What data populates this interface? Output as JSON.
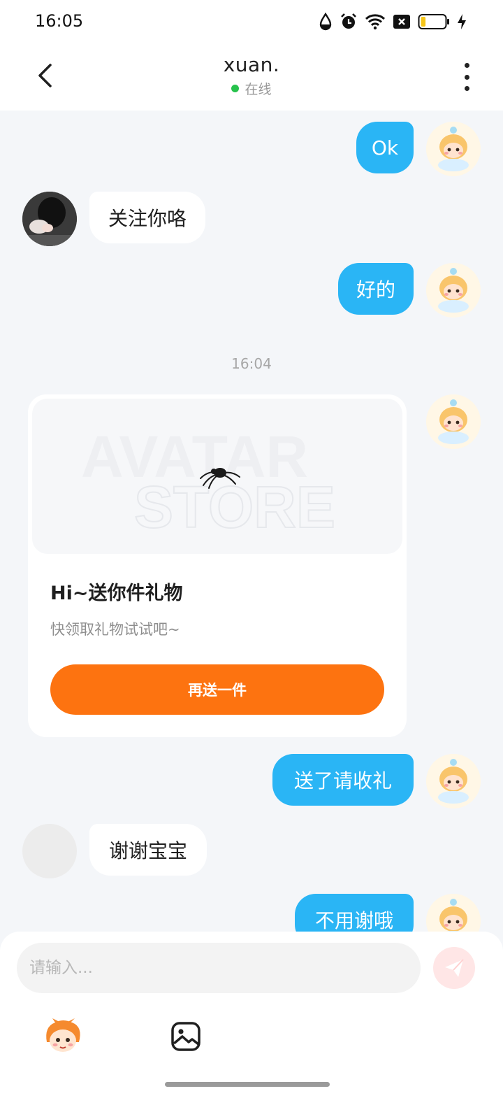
{
  "status_bar": {
    "time": "16:05",
    "icons": [
      "water-drop-icon",
      "alarm-icon",
      "wifi-icon",
      "sim-off-icon",
      "battery-icon",
      "charging-icon"
    ],
    "battery_level": 0.2
  },
  "header": {
    "title": "xuan.",
    "status": "在线",
    "status_color": "#27c24c"
  },
  "messages": [
    {
      "from": "me",
      "text": "Ok"
    },
    {
      "from": "peer",
      "text": "关注你咯"
    },
    {
      "from": "me",
      "text": "好的"
    },
    {
      "from": "me",
      "text": "送了请收礼"
    },
    {
      "from": "peer",
      "text": "谢谢宝宝"
    },
    {
      "from": "me",
      "text": "不用谢哦"
    }
  ],
  "timestamp": "16:04",
  "gift_card": {
    "watermark_line1": "AVATAR",
    "watermark_line2": "STORE",
    "title": "Hi~送你件礼物",
    "subtitle": "快领取礼物试试吧~",
    "button_label": "再送一件",
    "button_color": "#fd7310"
  },
  "composer": {
    "placeholder": "请输入...",
    "tools": [
      "avatar-sticker-icon",
      "image-icon"
    ]
  },
  "colors": {
    "my_bubble": "#2ab5f5",
    "peer_bubble": "#ffffff",
    "background": "#f4f6f9"
  }
}
